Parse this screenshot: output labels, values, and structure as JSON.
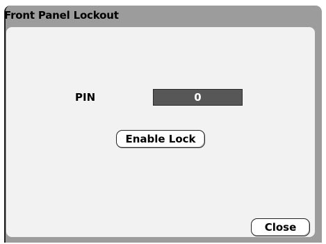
{
  "dialog": {
    "title": "Front Panel Lockout",
    "pin_label": "PIN",
    "pin_value": "0",
    "enable_lock_label": "Enable Lock",
    "close_label": "Close"
  },
  "colors": {
    "frame": "#9c9c9c",
    "panel": "#f2f2f2",
    "pin_field_bg": "#575757",
    "pin_field_text": "#ffffff",
    "button_bg": "#ffffff"
  }
}
